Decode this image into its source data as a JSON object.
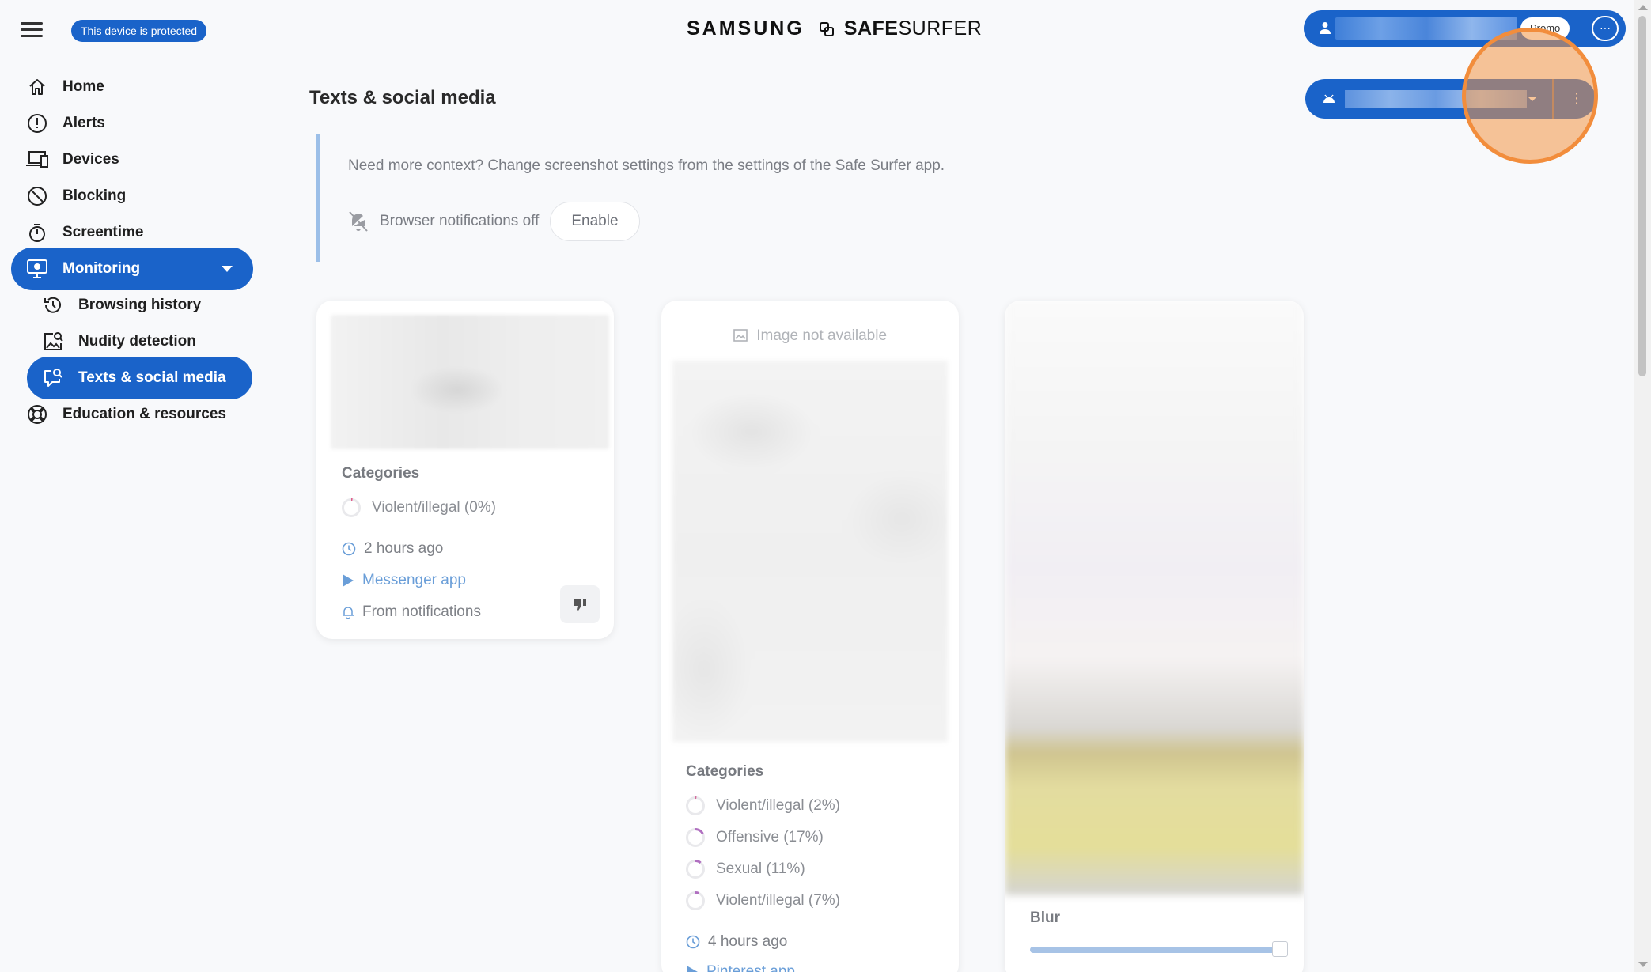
{
  "header": {
    "protected_badge": "This device is protected",
    "brand_samsung": "SAMSUNG",
    "brand_safe": "SAFE",
    "brand_surfer": "SURFER",
    "account_plan": "Promo",
    "more_label": "···"
  },
  "sidebar": {
    "items": [
      {
        "label": "Home",
        "icon": "home-icon"
      },
      {
        "label": "Alerts",
        "icon": "alert-circle-icon"
      },
      {
        "label": "Devices",
        "icon": "devices-icon"
      },
      {
        "label": "Blocking",
        "icon": "block-icon"
      },
      {
        "label": "Screentime",
        "icon": "stopwatch-icon"
      },
      {
        "label": "Monitoring",
        "icon": "monitor-icon",
        "active": true
      },
      {
        "label": "Browsing history",
        "icon": "history-icon"
      },
      {
        "label": "Nudity detection",
        "icon": "image-search-icon"
      },
      {
        "label": "Texts & social media",
        "icon": "chat-search-icon",
        "active": true
      },
      {
        "label": "Education & resources",
        "icon": "lifebuoy-icon"
      }
    ]
  },
  "main": {
    "title": "Texts & social media",
    "info_text": "Need more context? Change screenshot settings from the settings of the Safe Surfer app.",
    "notifications_status": "Browser notifications off",
    "enable_label": "Enable",
    "device_menu_dots": "⋮"
  },
  "cards": [
    {
      "categories_title": "Categories",
      "categories": [
        {
          "label": "Violent/illegal (0%)",
          "percent": 0
        }
      ],
      "time": "2 hours ago",
      "app": "Messenger app",
      "source": "From notifications"
    },
    {
      "image_unavailable": "Image not available",
      "categories_title": "Categories",
      "categories": [
        {
          "label": "Violent/illegal (2%)",
          "percent": 2
        },
        {
          "label": "Offensive (17%)",
          "percent": 17
        },
        {
          "label": "Sexual (11%)",
          "percent": 11
        },
        {
          "label": "Violent/illegal (7%)",
          "percent": 7
        }
      ],
      "time": "4 hours ago",
      "app": "Pinterest app"
    },
    {
      "blur_label": "Blur",
      "blur_level": 1.0
    }
  ],
  "colors": {
    "accent": "#1a63c9",
    "highlight": "#f28d3c",
    "ring": "#b06fc0"
  }
}
